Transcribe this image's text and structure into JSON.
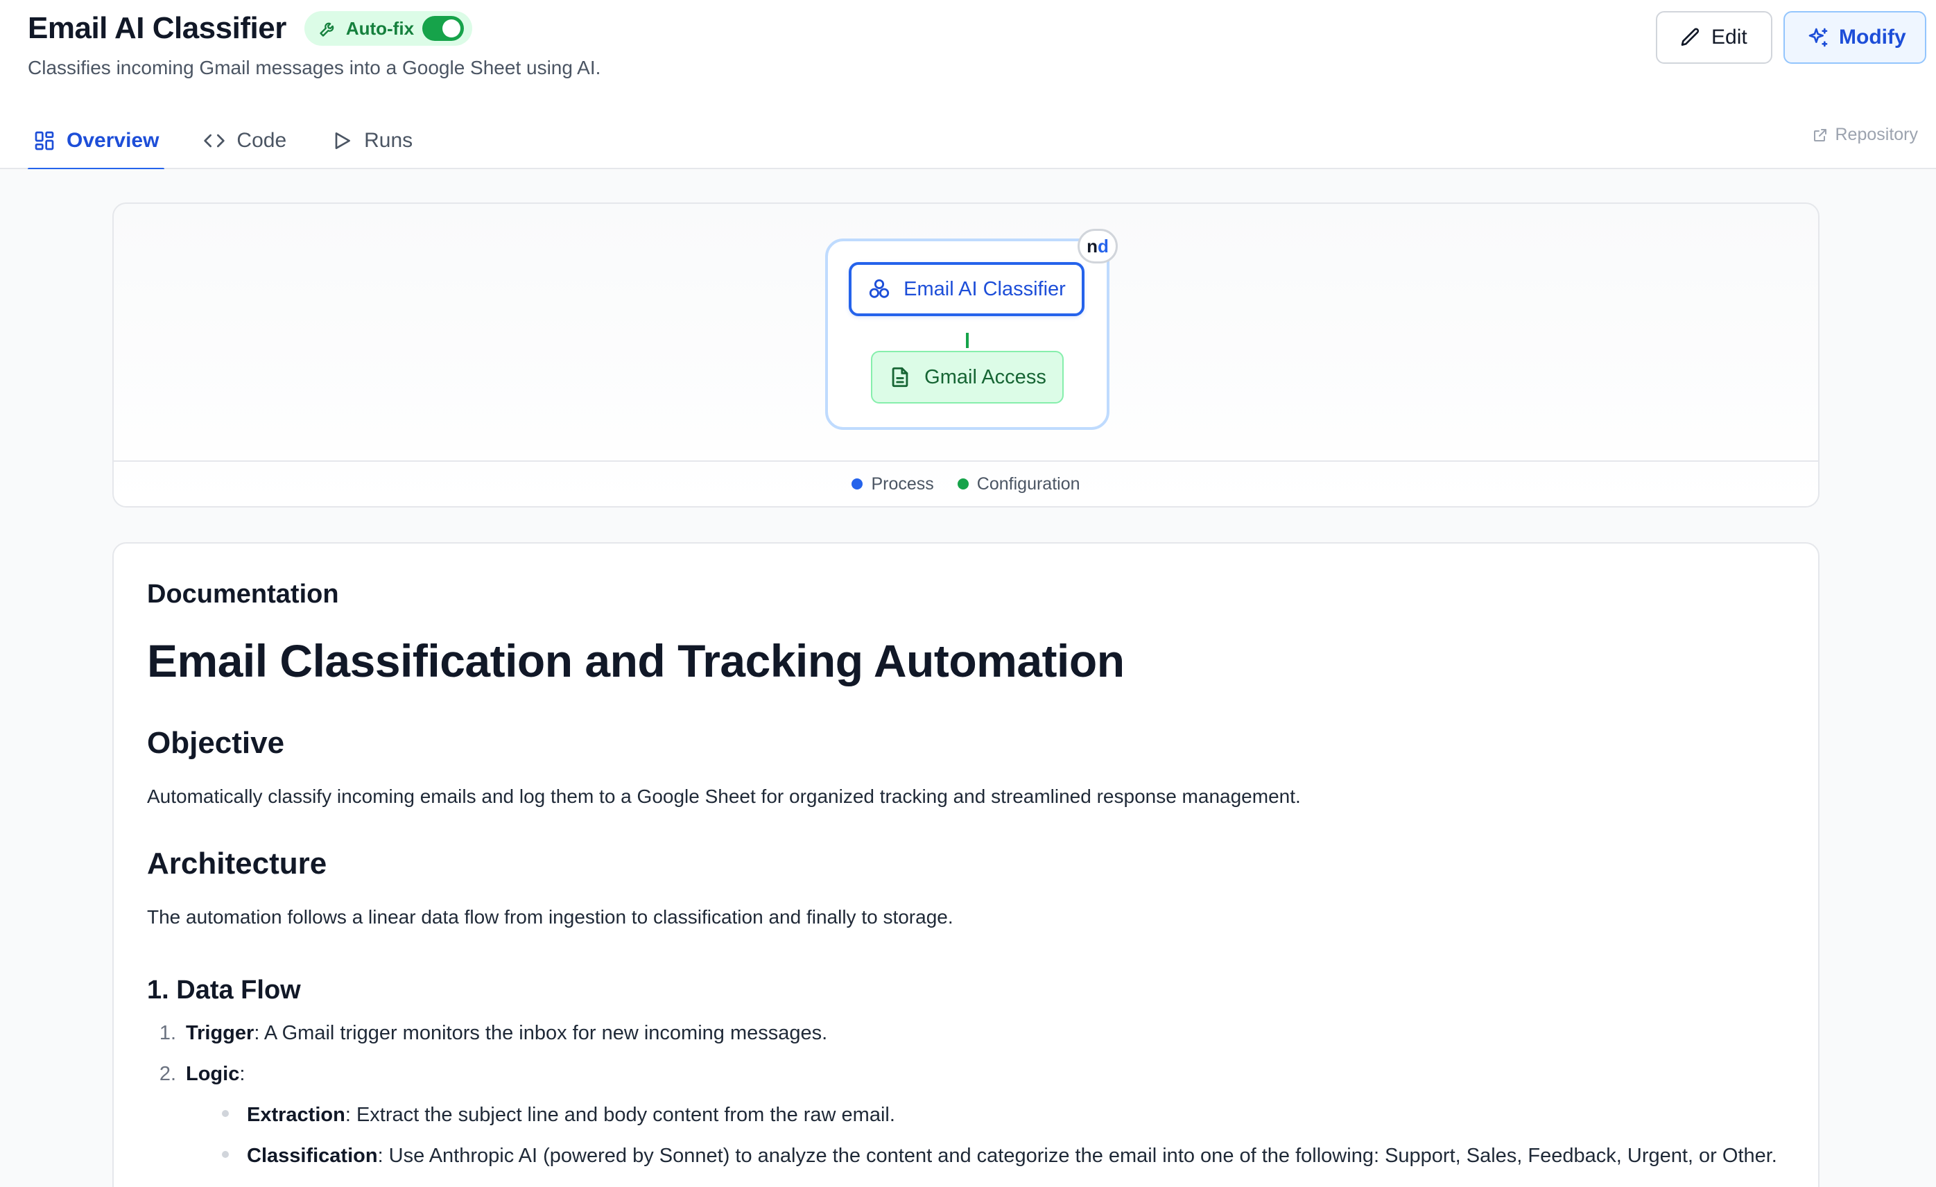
{
  "header": {
    "title": "Email AI Classifier",
    "autofix_label": "Auto-fix",
    "autofix_enabled": true,
    "subtitle": "Classifies incoming Gmail messages into a Google Sheet using AI.",
    "edit_label": "Edit",
    "modify_label": "Modify"
  },
  "tabs": [
    {
      "label": "Overview",
      "icon": "grid-icon",
      "active": true
    },
    {
      "label": "Code",
      "icon": "code-icon",
      "active": false
    },
    {
      "label": "Runs",
      "icon": "play-icon",
      "active": false
    }
  ],
  "repository_label": "Repository",
  "diagram": {
    "badge_n": "n",
    "badge_d": "d",
    "process_node": "Email AI Classifier",
    "config_node": "Gmail Access",
    "legend": [
      {
        "label": "Process",
        "color": "#2563eb"
      },
      {
        "label": "Configuration",
        "color": "#16a34a"
      }
    ]
  },
  "doc": {
    "label": "Documentation",
    "h1": "Email Classification and Tracking Automation",
    "objective_heading": "Objective",
    "objective_text": "Automatically classify incoming emails and log them to a Google Sheet for organized tracking and streamlined response management.",
    "architecture_heading": "Architecture",
    "architecture_text": "The automation follows a linear data flow from ingestion to classification and finally to storage.",
    "data_flow_heading": "1. Data Flow",
    "steps": [
      {
        "num": "1.",
        "term": "Trigger",
        "text": ": A Gmail trigger monitors the inbox for new incoming messages."
      },
      {
        "num": "2.",
        "term": "Logic",
        "text": ":"
      }
    ],
    "logic_items": [
      {
        "term": "Extraction",
        "text": ": Extract the subject line and body content from the raw email."
      },
      {
        "term": "Classification",
        "text": ": Use Anthropic AI (powered by Sonnet) to analyze the content and categorize the email into one of the following: Support, Sales, Feedback, Urgent, or Other."
      }
    ]
  },
  "colors": {
    "accent": "#2563eb",
    "success": "#16a34a"
  }
}
